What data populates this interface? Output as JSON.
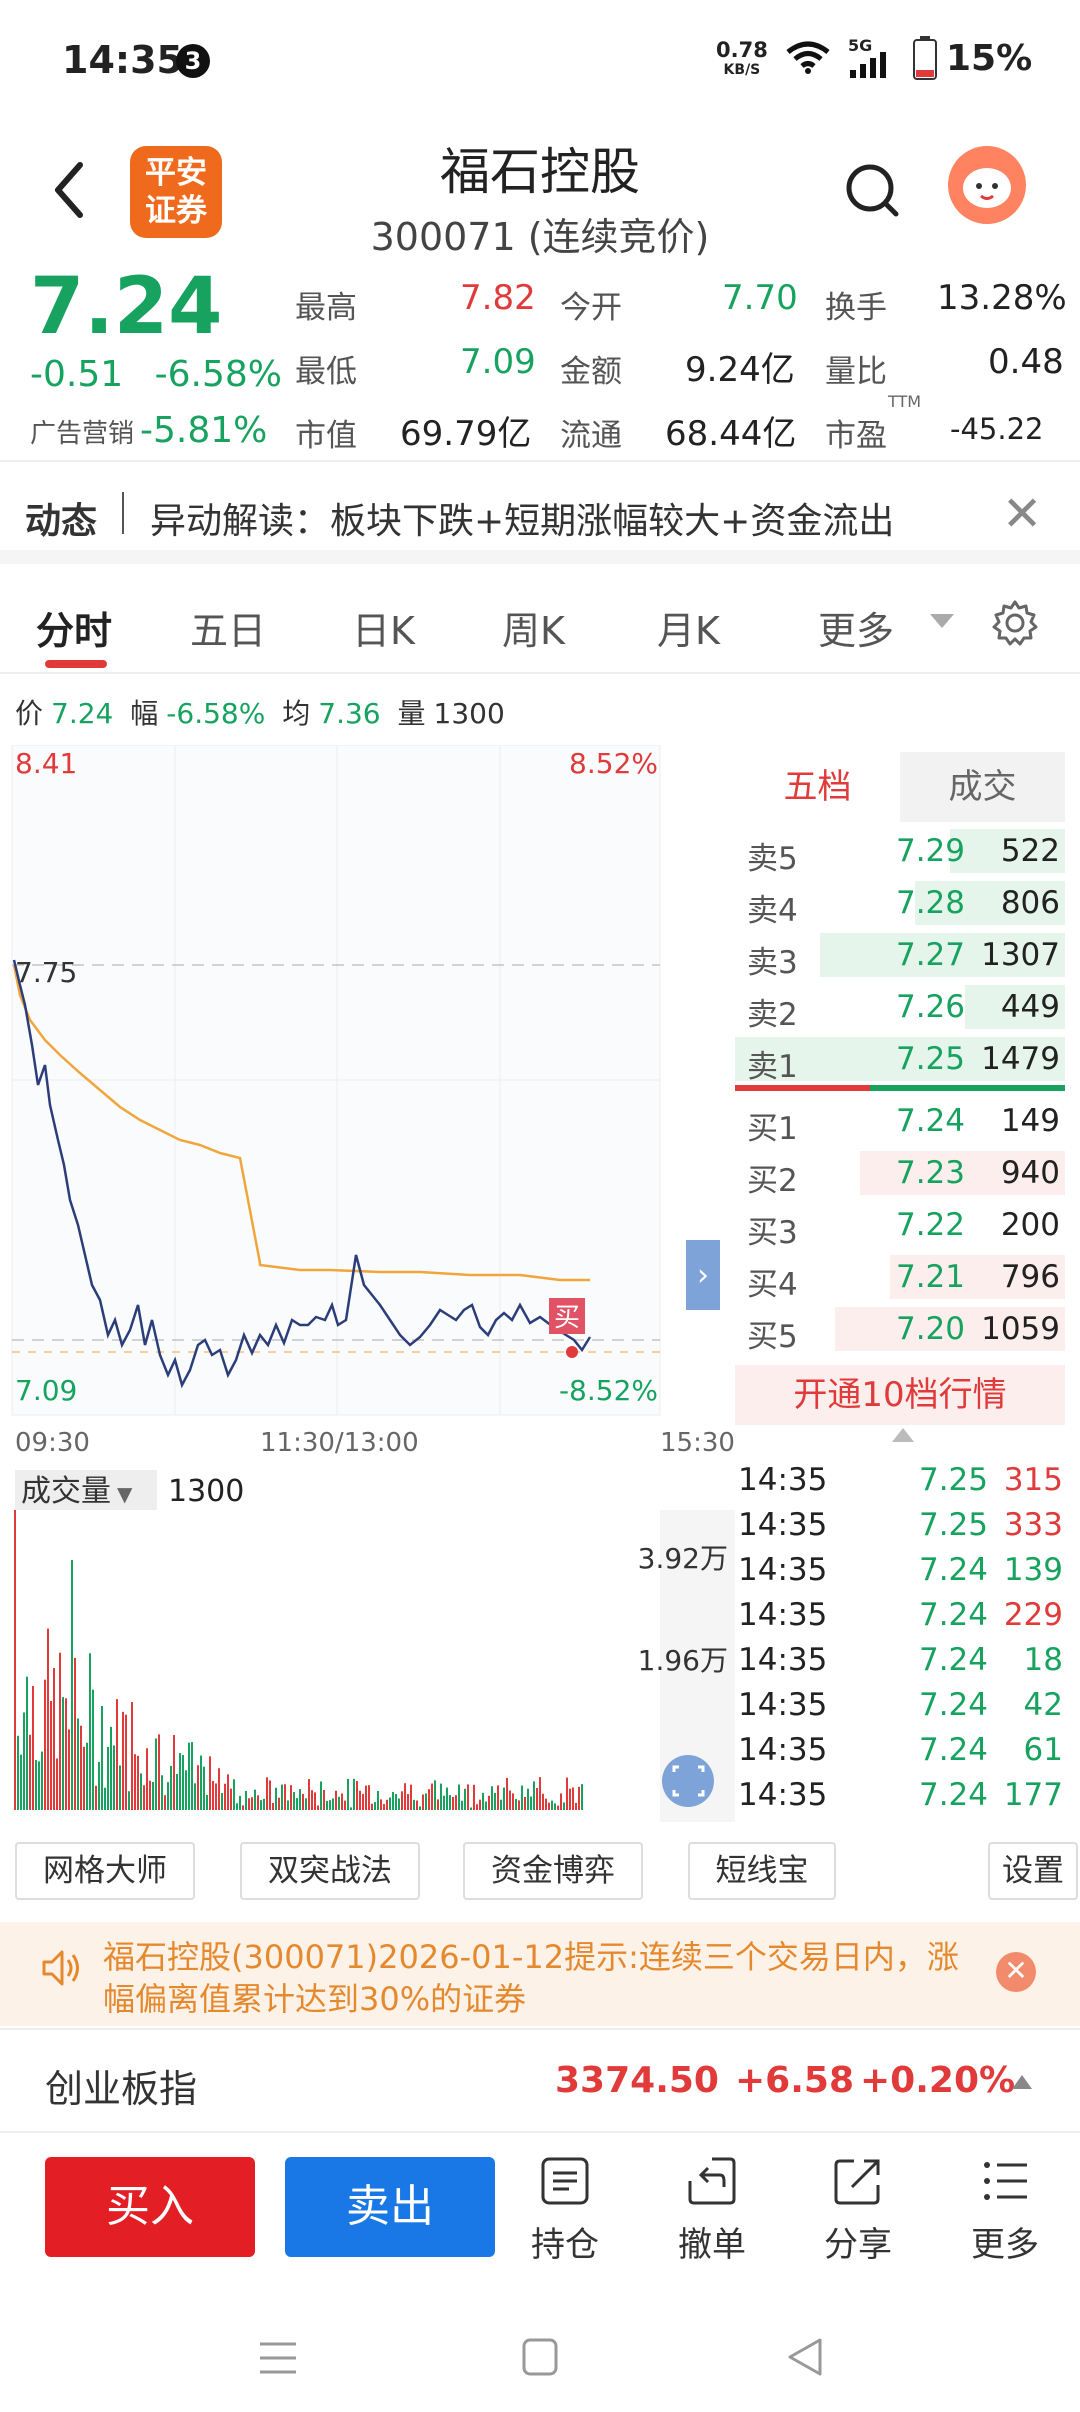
{
  "status": {
    "time": "14:35",
    "notif_count": "3",
    "speed_value": "0.78",
    "speed_unit": "KB/S",
    "network": "5G",
    "battery": "15%"
  },
  "header": {
    "logo_line1": "平安",
    "logo_line2": "证券",
    "stock_name": "福石控股",
    "stock_code": "300071 (连续竞价)"
  },
  "quote": {
    "price": "7.24",
    "change": "-0.51",
    "change_pct": "-6.58%",
    "ad_label": "广告营销",
    "ad_value": "-5.81%",
    "high_label": "最高",
    "high": "7.82",
    "low_label": "最低",
    "low": "7.09",
    "mcap_label": "市值",
    "mcap": "69.79亿",
    "open_label": "今开",
    "open": "7.70",
    "amount_label": "金额",
    "amount": "9.24亿",
    "float_label": "流通",
    "float": "68.44亿",
    "turnover_label": "换手",
    "turnover": "13.28%",
    "volratio_label": "量比",
    "volratio": "0.48",
    "pe_label": "市盈",
    "pe_sup": "TTM",
    "pe": "-45.22"
  },
  "news": {
    "tag": "动态",
    "text": "异动解读：板块下跌+短期涨幅较大+资金流出"
  },
  "tabs": [
    {
      "label": "分时"
    },
    {
      "label": "五日"
    },
    {
      "label": "日K"
    },
    {
      "label": "周K"
    },
    {
      "label": "月K"
    },
    {
      "label": "更多"
    }
  ],
  "infoline": {
    "price_label": "价",
    "price": "7.24",
    "pct_label": "幅",
    "pct": "-6.58%",
    "avg_label": "均",
    "avg": "7.36",
    "vol_label": "量",
    "vol": "1300"
  },
  "chart_labels": {
    "top_price": "8.41",
    "top_pct": "8.52%",
    "mid_price": "7.75",
    "bottom_price": "7.09",
    "bottom_pct": "-8.52%",
    "buy_marker": "买"
  },
  "time_axis": {
    "start": "09:30",
    "mid": "11:30/13:00",
    "end": "15:30"
  },
  "orderbook": {
    "tab_active": "五档",
    "tab_other": "成交",
    "asks": [
      {
        "label": "卖5",
        "price": "7.29",
        "vol": "522"
      },
      {
        "label": "卖4",
        "price": "7.28",
        "vol": "806"
      },
      {
        "label": "卖3",
        "price": "7.27",
        "vol": "1307"
      },
      {
        "label": "卖2",
        "price": "7.26",
        "vol": "449"
      },
      {
        "label": "卖1",
        "price": "7.25",
        "vol": "1479"
      }
    ],
    "bids": [
      {
        "label": "买1",
        "price": "7.24",
        "vol": "149"
      },
      {
        "label": "买2",
        "price": "7.23",
        "vol": "940"
      },
      {
        "label": "买3",
        "price": "7.22",
        "vol": "200"
      },
      {
        "label": "买4",
        "price": "7.21",
        "vol": "796"
      },
      {
        "label": "买5",
        "price": "7.20",
        "vol": "1059"
      }
    ],
    "open10": "开通10档行情"
  },
  "volume": {
    "label": "成交量",
    "value": "1300",
    "max_label": "3.92万",
    "mid_label": "1.96万"
  },
  "ticks": [
    {
      "time": "14:35",
      "price": "7.25",
      "vol": "315",
      "dir": "up"
    },
    {
      "time": "14:35",
      "price": "7.25",
      "vol": "333",
      "dir": "up"
    },
    {
      "time": "14:35",
      "price": "7.24",
      "vol": "139",
      "dir": "down"
    },
    {
      "time": "14:35",
      "price": "7.24",
      "vol": "229",
      "dir": "up"
    },
    {
      "time": "14:35",
      "price": "7.24",
      "vol": "18",
      "dir": "down"
    },
    {
      "time": "14:35",
      "price": "7.24",
      "vol": "42",
      "dir": "down"
    },
    {
      "time": "14:35",
      "price": "7.24",
      "vol": "61",
      "dir": "down"
    },
    {
      "time": "14:35",
      "price": "7.24",
      "vol": "177",
      "dir": "down"
    }
  ],
  "tools": [
    "网格大师",
    "双突战法",
    "资金博弈",
    "短线宝",
    "设置"
  ],
  "alert": {
    "text": "福石控股(300071)2026-01-12提示:连续三个交易日内，涨幅偏离值累计达到30%的证券"
  },
  "index": {
    "name": "创业板指",
    "value": "3374.50",
    "change": "+6.58",
    "pct": "+0.20%"
  },
  "trade": {
    "buy": "买入",
    "sell": "卖出",
    "hold": "持仓",
    "cancel": "撤单",
    "share": "分享",
    "more": "更多"
  },
  "colors": {
    "up": "#e03a3a",
    "down": "#17a35f",
    "price_line": "#2c3e7a",
    "avg_line": "#f0a63c",
    "buy_btn": "#e31e24",
    "sell_btn": "#1a78e6"
  }
}
